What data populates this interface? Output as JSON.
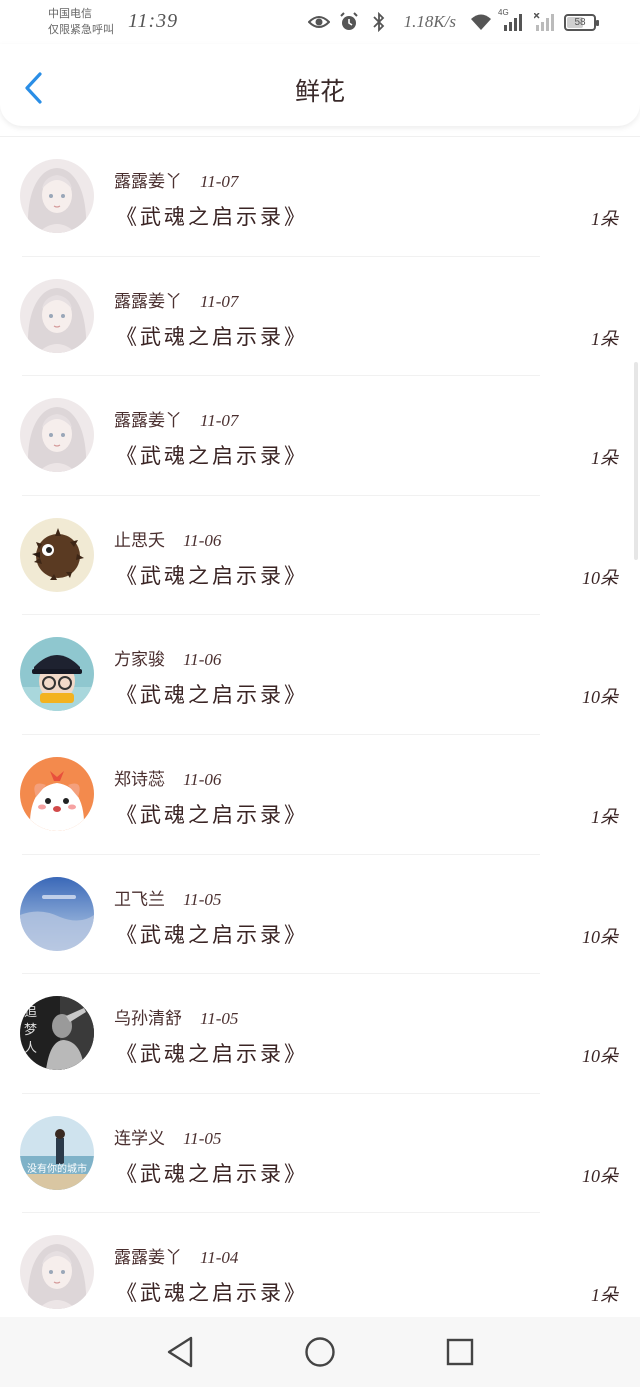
{
  "status_bar": {
    "carrier_line1": "中国电信",
    "carrier_line2": "仅限紧急呼叫",
    "time": "11:39",
    "net_speed": "1.18K/s",
    "network_badge": "4G",
    "battery": "58",
    "icons": [
      "eye-icon",
      "alarm-icon",
      "bluetooth-icon",
      "wifi-icon",
      "signal-icon",
      "signal-off-icon",
      "battery-icon"
    ]
  },
  "header": {
    "title": "鲜花",
    "back_icon": "chevron-left-icon",
    "accent_color": "#2a8ee6"
  },
  "items": [
    {
      "name": "露露姜丫",
      "date": "11-07",
      "book": "《武魂之启示录》",
      "count": "1朵",
      "avatar": "anime-girl"
    },
    {
      "name": "露露姜丫",
      "date": "11-07",
      "book": "《武魂之启示录》",
      "count": "1朵",
      "avatar": "anime-girl"
    },
    {
      "name": "露露姜丫",
      "date": "11-07",
      "book": "《武魂之启示录》",
      "count": "1朵",
      "avatar": "anime-girl"
    },
    {
      "name": "止思夭",
      "date": "11-06",
      "book": "《武魂之启示录》",
      "count": "10朵",
      "avatar": "hedgehog"
    },
    {
      "name": "方家骏",
      "date": "11-06",
      "book": "《武魂之启示录》",
      "count": "10朵",
      "avatar": "boy-cap"
    },
    {
      "name": "郑诗蕊",
      "date": "11-06",
      "book": "《武魂之启示录》",
      "count": "1朵",
      "avatar": "cartoon-dog"
    },
    {
      "name": "卫飞兰",
      "date": "11-05",
      "book": "《武魂之启示录》",
      "count": "10朵",
      "avatar": "sky"
    },
    {
      "name": "乌孙清舒",
      "date": "11-05",
      "book": "《武魂之启示录》",
      "count": "10朵",
      "avatar": "bw-figure",
      "avatar_text": "追梦人"
    },
    {
      "name": "连学义",
      "date": "11-05",
      "book": "《武魂之启示录》",
      "count": "10朵",
      "avatar": "beach",
      "avatar_text": "没有你的城市"
    },
    {
      "name": "露露姜丫",
      "date": "11-04",
      "book": "《武魂之启示录》",
      "count": "1朵",
      "avatar": "anime-girl"
    }
  ],
  "navbar": {
    "icons": [
      "back-triangle-icon",
      "home-circle-icon",
      "recents-square-icon"
    ]
  }
}
